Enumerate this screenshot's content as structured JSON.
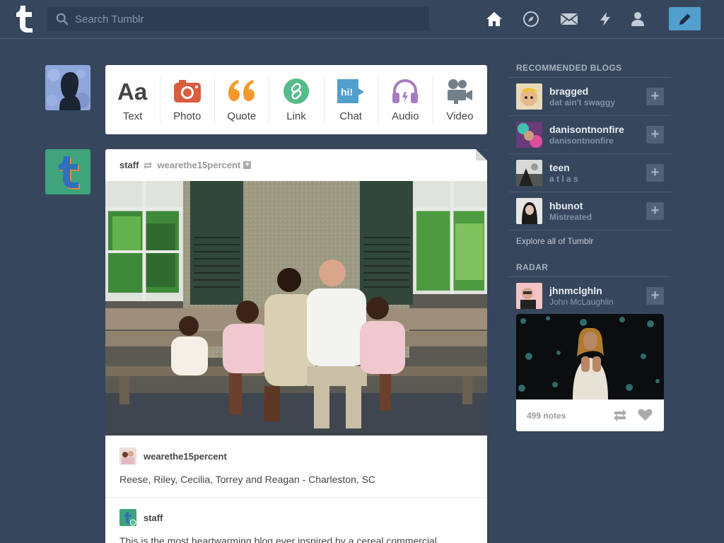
{
  "header": {
    "search_placeholder": "Search Tumblr",
    "nav_icons": [
      "home-icon",
      "explore-icon",
      "mail-icon",
      "lightning-icon",
      "account-icon"
    ],
    "compose_icon": "pencil-icon",
    "accent": "#529ecc",
    "background": "#36465d"
  },
  "post_types": [
    {
      "label": "Text",
      "icon": "text-icon",
      "color": "#444444"
    },
    {
      "label": "Photo",
      "icon": "camera-icon",
      "color": "#d95e40"
    },
    {
      "label": "Quote",
      "icon": "quote-icon",
      "color": "#f2992e"
    },
    {
      "label": "Link",
      "icon": "link-icon",
      "color": "#56bc8a"
    },
    {
      "label": "Chat",
      "icon": "chat-icon",
      "color": "#529ecc"
    },
    {
      "label": "Audio",
      "icon": "headphones-icon",
      "color": "#a77dc2"
    },
    {
      "label": "Video",
      "icon": "video-camera-icon",
      "color": "#748089"
    }
  ],
  "post": {
    "author": "staff",
    "reblogged_from": "wearethe15percent",
    "photo_subject": "family-photo",
    "reblog_1": {
      "name": "wearethe15percent",
      "caption": "Reese, Riley, Cecilia, Torrey and Reagan - Charleston, SC"
    },
    "reblog_2": {
      "name": "staff",
      "caption": "This is the most heartwarming blog ever inspired by a cereal commercial."
    }
  },
  "recommended": {
    "title": "RECOMMENDED BLOGS",
    "blogs": [
      {
        "name": "bragged",
        "sub": "dat ain't swaggy"
      },
      {
        "name": "danisontnonfire",
        "sub": "danisontnonfire"
      },
      {
        "name": "teen",
        "sub": "a t l a s"
      },
      {
        "name": "hbunot",
        "sub": "Mistreated"
      }
    ],
    "explore": "Explore all of Tumblr"
  },
  "radar": {
    "title": "RADAR",
    "blog_name": "jhnmclghln",
    "blog_sub": "John McLaughlin",
    "notes": "499 notes"
  }
}
